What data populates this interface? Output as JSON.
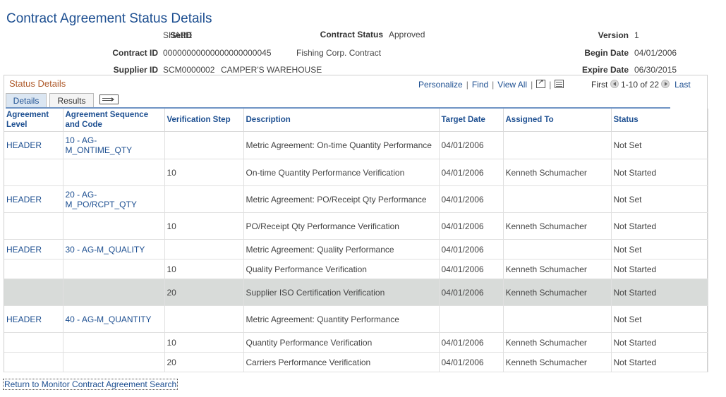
{
  "page": {
    "title": "Contract Agreement Status Details"
  },
  "header": {
    "setid_label": "SetID",
    "setid_value": "SHARE",
    "contract_status_label": "Contract Status",
    "contract_status_value": "Approved",
    "version_label": "Version",
    "version_value": "1",
    "contract_id_label": "Contract ID",
    "contract_id_value": "00000000000000000000045",
    "contract_desc": "Fishing Corp. Contract",
    "begin_date_label": "Begin Date",
    "begin_date_value": "04/01/2006",
    "supplier_id_label": "Supplier ID",
    "supplier_id_value": "SCM0000002",
    "supplier_name": "CAMPER'S WAREHOUSE",
    "expire_date_label": "Expire Date",
    "expire_date_value": "06/30/2015"
  },
  "grid": {
    "title": "Status Details",
    "personalize": "Personalize",
    "find": "Find",
    "view_all": "View All",
    "first": "First",
    "range": "1-10 of 22",
    "last": "Last",
    "tabs": {
      "details": "Details",
      "results": "Results"
    },
    "columns": [
      "Agreement Level",
      "Agreement Sequence and Code",
      "Verification Step",
      "Description",
      "Target Date",
      "Assigned To",
      "Status"
    ],
    "rows": [
      [
        "HEADER",
        "10 - AG-M_ONTIME_QTY",
        "",
        "Metric Agreement: On-time Quantity Performance",
        "04/01/2006",
        "",
        "Not Set"
      ],
      [
        "",
        "",
        "10",
        "On-time Quantity Performance Verification",
        "04/01/2006",
        "Kenneth Schumacher",
        "Not Started"
      ],
      [
        "HEADER",
        "20 - AG-M_PO/RCPT_QTY",
        "",
        "Metric Agreement: PO/Receipt Qty Performance",
        "04/01/2006",
        "",
        "Not Set"
      ],
      [
        "",
        "",
        "10",
        "PO/Receipt Qty Performance Verification",
        "04/01/2006",
        "Kenneth Schumacher",
        "Not Started"
      ],
      [
        "HEADER",
        "30 - AG-M_QUALITY",
        "",
        "Metric Agreement: Quality Performance",
        "04/01/2006",
        "",
        "Not Set"
      ],
      [
        "",
        "",
        "10",
        "Quality Performance Verification",
        "04/01/2006",
        "Kenneth Schumacher",
        "Not Started"
      ],
      [
        "",
        "",
        "20",
        "Supplier ISO Certification Verification",
        "04/01/2006",
        "Kenneth Schumacher",
        "Not Started"
      ],
      [
        "HEADER",
        "40 - AG-M_QUANTITY",
        "",
        "Metric Agreement: Quantity Performance",
        "",
        "",
        "Not Set"
      ],
      [
        "",
        "",
        "10",
        "Quantity Performance Verification",
        "04/01/2006",
        "Kenneth Schumacher",
        "Not Started"
      ],
      [
        "",
        "",
        "20",
        "Carriers Performance Verification",
        "04/01/2006",
        "Kenneth Schumacher",
        "Not Started"
      ]
    ],
    "highlighted_row": 6
  },
  "footer": {
    "return_link": "Return to Monitor Contract Agreement Search"
  }
}
